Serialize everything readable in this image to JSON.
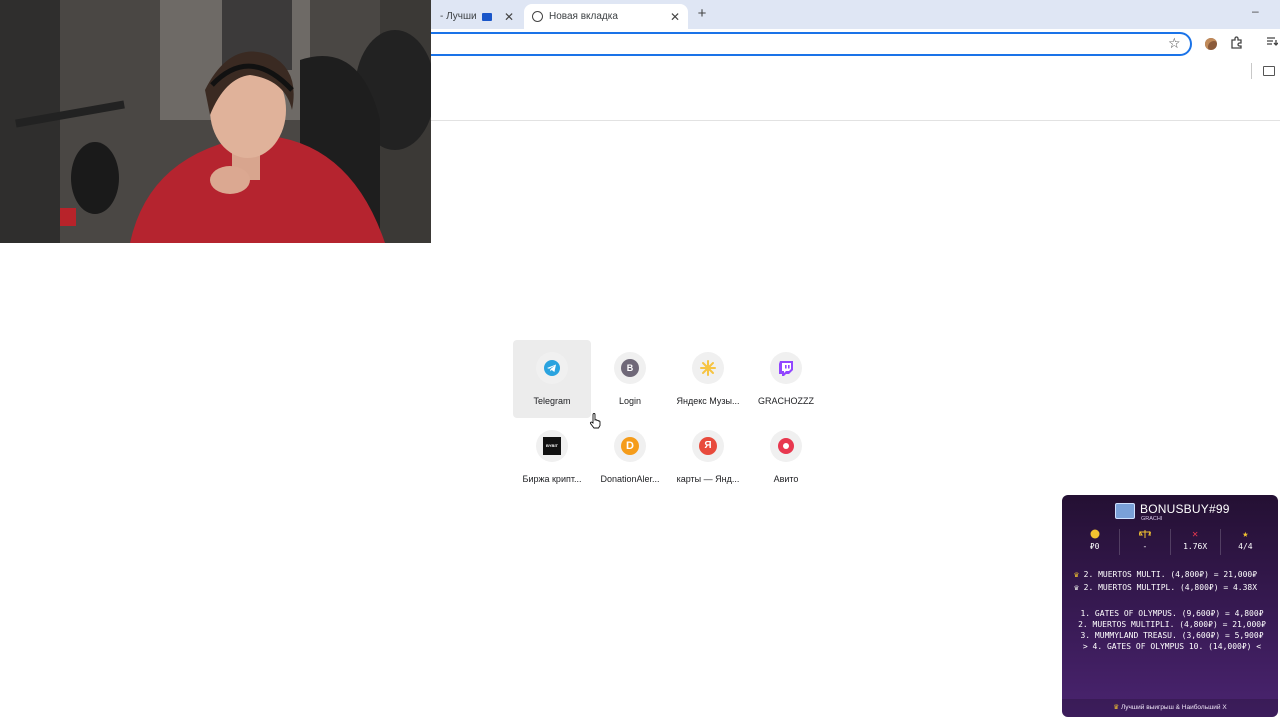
{
  "browser": {
    "tabs": [
      {
        "title": "- Лучшие он",
        "active": false,
        "close": "✕"
      },
      {
        "title": "Новая вкладка",
        "active": true,
        "close": "✕"
      }
    ],
    "new_tab_label": "+",
    "minimize_label": "–",
    "accent_color": "#1a73e8"
  },
  "webcam": {
    "description_icon": "webcam-feed"
  },
  "shortcuts": [
    {
      "label": "Telegram",
      "icon": "telegram-icon",
      "color": "#2aa3df"
    },
    {
      "label": "Login",
      "icon": "login-b-icon",
      "letter": "B",
      "color": "#6f6878"
    },
    {
      "label": "Яндекс Музы...",
      "icon": "yandex-music-icon",
      "color": "#f6c443"
    },
    {
      "label": "GRACHOZZZ",
      "icon": "twitch-icon",
      "color": "#9146ff"
    },
    {
      "label": "Биржа крипт...",
      "icon": "exchange-icon",
      "letter": "BYBIT",
      "color": "#111111"
    },
    {
      "label": "DonationAler...",
      "icon": "donationalerts-icon",
      "letter": "D",
      "color": "#f59c1a"
    },
    {
      "label": "карты — Янд...",
      "icon": "yandex-maps-icon",
      "letter": "Я",
      "color": "#e84a3c"
    },
    {
      "label": "Авито",
      "icon": "avito-icon",
      "color": "#e8384f"
    }
  ],
  "bonusbuy": {
    "title": "BONUSBUY#99",
    "subtitle": "GRACHI",
    "stats": [
      {
        "icon": "coin-icon",
        "value": "₽0"
      },
      {
        "icon": "scales-icon",
        "value": "-"
      },
      {
        "icon": "x-icon",
        "value": "1.76X"
      },
      {
        "icon": "star-icon",
        "value": "4/4"
      }
    ],
    "best": [
      "2. MUERTOS MULTI. (4,800₽) = 21,000₽",
      "2. MUERTOS MULTIPL. (4,800₽) = 4.38X"
    ],
    "list": [
      "1. GATES OF OLYMPUS. (9,600₽) =  4,800₽",
      "2. MUERTOS MULTIPLI. (4,800₽) = 21,000₽",
      "3. MUMMYLAND TREASU. (3,600₽) =  5,900₽",
      "> 4. GATES OF OLYMPUS 10. (14,000₽) <"
    ],
    "footer": "Лучший выигрыш & Наибольший X"
  }
}
